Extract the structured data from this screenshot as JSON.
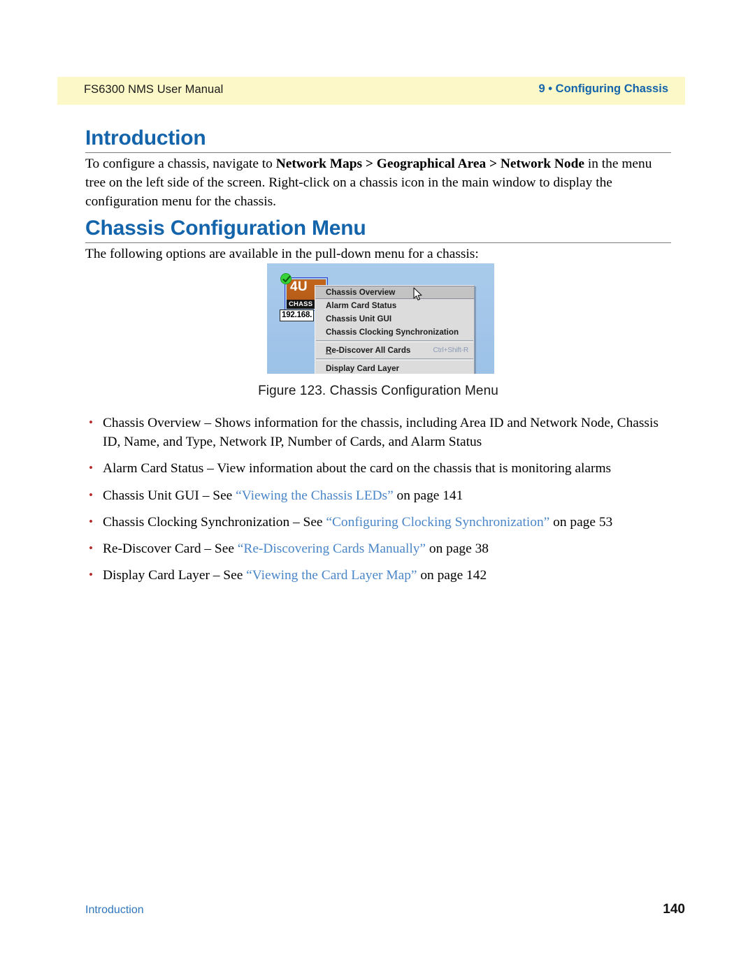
{
  "header": {
    "left_text": "FS6300 NMS User Manual",
    "right_text": "9 • Configuring Chassis",
    "band_color": "#fdf8c8",
    "accent_color": "#1464ab"
  },
  "sections": [
    {
      "heading": "Introduction",
      "paragraph_parts": [
        {
          "text": "To configure a chassis, navigate to ",
          "bold": false
        },
        {
          "text": "Network Maps > Geographical Area > Network Node",
          "bold": true
        },
        {
          "text": " in the menu tree on the left side of the screen. Right-click on a chassis icon in the main window to display the configuration menu for the chassis.",
          "bold": false
        }
      ]
    },
    {
      "heading": "Chassis Configuration Menu",
      "paragraph_parts": [
        {
          "text": "The following options are available in the pull-down menu for a chassis:",
          "bold": false
        }
      ]
    }
  ],
  "figure": {
    "caption": "Figure 123. Chassis Configuration Menu",
    "background_color": "#a4c6e9",
    "node": {
      "label": "4U",
      "band_label": "CHASS",
      "ip_label": "192.168.",
      "status_icon": "green-check-icon",
      "body_color": "#b55c18",
      "selection_color": "#2b3fd0"
    },
    "context_menu": {
      "items": [
        {
          "label": "Chassis Overview",
          "selected": true,
          "shortcut": "",
          "mnemonic": "",
          "separator_after": false
        },
        {
          "label": "Alarm Card Status",
          "selected": false,
          "shortcut": "",
          "mnemonic": "",
          "separator_after": false
        },
        {
          "label": "Chassis Unit GUI",
          "selected": false,
          "shortcut": "",
          "mnemonic": "",
          "separator_after": false
        },
        {
          "label": "Chassis Clocking Synchronization",
          "selected": false,
          "shortcut": "",
          "mnemonic": "",
          "separator_after": true
        },
        {
          "label": "Re-Discover All Cards",
          "selected": false,
          "shortcut": "Ctrl+Shift-R",
          "mnemonic": "R",
          "separator_after": true
        },
        {
          "label": "Display Card Layer",
          "selected": false,
          "shortcut": "",
          "mnemonic": "",
          "separator_after": false
        }
      ],
      "cursor_icon": "mouse-pointer-icon"
    }
  },
  "bullets": [
    {
      "parts": [
        {
          "text": "Chassis Overview – Shows information for the chassis, including Area ID and Network Node, Chassis ID, Name, and Type, Network IP, Number of Cards, and Alarm Status",
          "link": false
        }
      ]
    },
    {
      "parts": [
        {
          "text": "Alarm Card Status – View information about the card on the chassis that is monitoring alarms",
          "link": false
        }
      ]
    },
    {
      "parts": [
        {
          "text": "Chassis Unit GUI – See ",
          "link": false
        },
        {
          "text": "“Viewing the Chassis LEDs”",
          "link": true
        },
        {
          "text": " on page 141",
          "link": false
        }
      ]
    },
    {
      "parts": [
        {
          "text": "Chassis Clocking Synchronization – See ",
          "link": false
        },
        {
          "text": "“Configuring Clocking Synchronization”",
          "link": true
        },
        {
          "text": " on page 53",
          "link": false
        }
      ]
    },
    {
      "parts": [
        {
          "text": "Re-Discover Card – See ",
          "link": false
        },
        {
          "text": "“Re-Discovering Cards Manually”",
          "link": true
        },
        {
          "text": " on page 38",
          "link": false
        }
      ]
    },
    {
      "parts": [
        {
          "text": "Display Card Layer – See ",
          "link": false
        },
        {
          "text": "“Viewing the Card Layer Map”",
          "link": true
        },
        {
          "text": " on page 142",
          "link": false
        }
      ]
    }
  ],
  "footer": {
    "left_text": "Introduction",
    "page_number": "140"
  }
}
